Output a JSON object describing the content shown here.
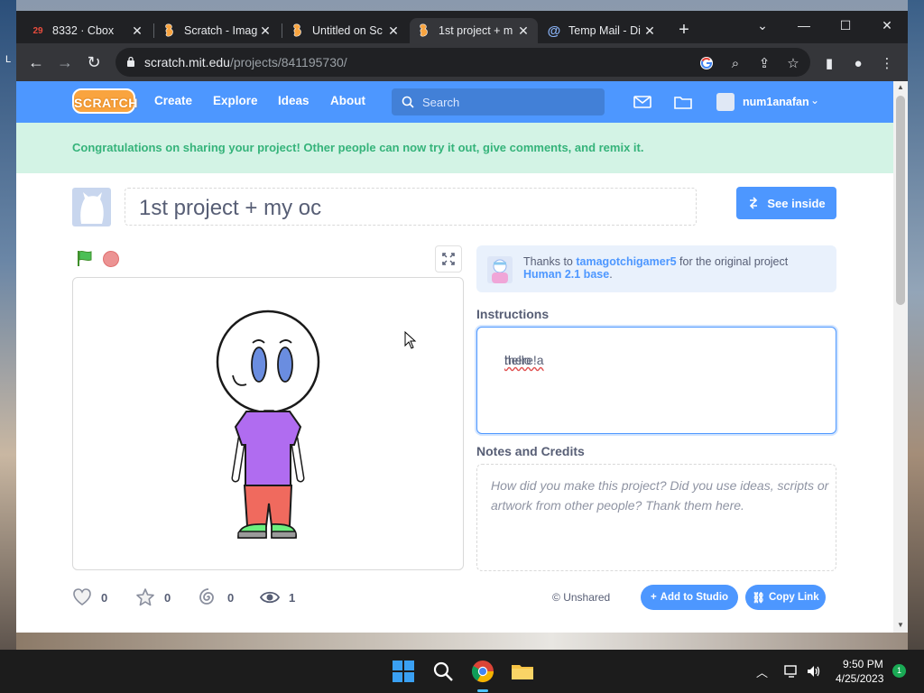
{
  "browser": {
    "tabs": [
      {
        "label": "8332 · Cbox",
        "badge": "29"
      },
      {
        "label": "Scratch - Imag"
      },
      {
        "label": "Untitled on Sc"
      },
      {
        "label": "1st project + m",
        "active": true
      },
      {
        "label": "Temp Mail - Di"
      }
    ],
    "url_host": "scratch.mit.edu",
    "url_path": "/projects/841195730/"
  },
  "scratch_nav": {
    "logo": "SCRATCH",
    "links": [
      "Create",
      "Explore",
      "Ideas",
      "About"
    ],
    "search_placeholder": "Search",
    "username": "num1anafan"
  },
  "banner": "Congratulations on sharing your project! Other people can now try it out, give comments, and remix it.",
  "project": {
    "title": "1st project + my oc",
    "see_inside": "See inside",
    "remix": {
      "prefix": "Thanks to",
      "user": "tamagotchigamer5",
      "middle": "for the original project",
      "project": "Human 2.1 base",
      "suffix": "."
    },
    "instructions_label": "Instructions",
    "instructions_text_prefix": "hello ",
    "instructions_text_word": "there!a",
    "notes_label": "Notes and Credits",
    "notes_placeholder": "How did you make this project? Did you use ideas, scripts or artwork from other people? Thank them here."
  },
  "stats": {
    "loves": "0",
    "favorites": "0",
    "remixes": "0",
    "views": "1"
  },
  "share": {
    "status": "Unshared",
    "add_to_studio": "Add to Studio",
    "copy_link": "Copy Link"
  },
  "taskbar": {
    "time": "9:50 PM",
    "date": "4/25/2023",
    "notifications": "1"
  },
  "colors": {
    "scratch_blue": "#4d97ff",
    "banner_green": "#35b37a",
    "banner_bg": "#d3f3e5",
    "stop_red": "#ec9393"
  }
}
